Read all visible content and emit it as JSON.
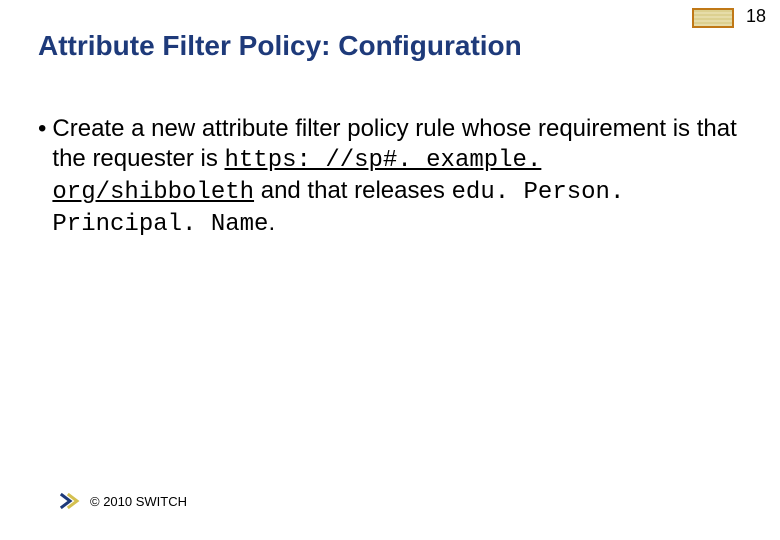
{
  "page_number": "18",
  "title": "Attribute Filter Policy: Configuration",
  "bullet": {
    "lead": "Create a new attribute filter policy rule whose requirement is that the requester is ",
    "url": "https: //sp#. example. org/shibboleth",
    "mid": " and that releases ",
    "attr": "edu. Person. Principal. Name",
    "tail": "."
  },
  "footer": {
    "copyright": "© 2010 SWITCH"
  }
}
